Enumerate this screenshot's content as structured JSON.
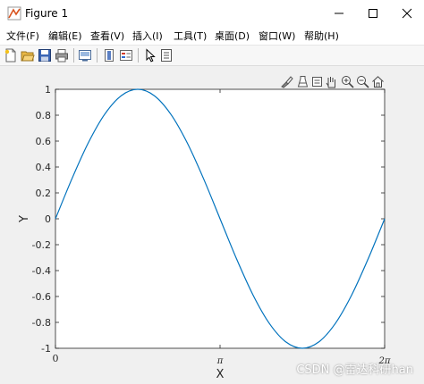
{
  "window": {
    "title": "Figure 1"
  },
  "menu": [
    {
      "label": "文件(F)"
    },
    {
      "label": "编辑(E)"
    },
    {
      "label": "查看(V)"
    },
    {
      "label": "插入(I)"
    },
    {
      "label": "工具(T)"
    },
    {
      "label": "桌面(D)"
    },
    {
      "label": "窗口(W)"
    },
    {
      "label": "帮助(H)"
    }
  ],
  "toolbar_icons": [
    "new-figure-icon",
    "open-file-icon",
    "save-icon",
    "print-icon",
    "link-plot-icon",
    "colorbar-icon",
    "legend-icon",
    "edit-plot-arrow-icon",
    "property-inspector-icon"
  ],
  "axes_toolbar_icons": [
    "brush-icon",
    "data-tips-icon",
    "pan-icon",
    "zoom-in-icon",
    "zoom-out-icon",
    "home-icon"
  ],
  "chart_data": {
    "type": "line",
    "function": "sin(x)",
    "xlabel": "X",
    "ylabel": "Y",
    "xlim": [
      0,
      6.2832
    ],
    "ylim": [
      -1,
      1
    ],
    "xticks": [
      0,
      3.1416,
      6.2832
    ],
    "xtick_labels": [
      "0",
      "π",
      "2π"
    ],
    "yticks": [
      1,
      0.8,
      0.6,
      0.4,
      0.2,
      0,
      -0.2,
      -0.4,
      -0.6,
      -0.8,
      -1
    ],
    "ytick_labels": [
      "1",
      "0.8",
      "0.6",
      "0.4",
      "0.2",
      "0",
      "-0.2",
      "-0.4",
      "-0.6",
      "-0.8",
      "-1"
    ],
    "series": [
      {
        "color": "#0072bd",
        "x": [
          0,
          0.3142,
          0.6283,
          0.9425,
          1.2566,
          1.5708,
          1.885,
          2.1991,
          2.5133,
          2.8274,
          3.1416,
          3.4558,
          3.7699,
          4.0841,
          4.3982,
          4.7124,
          5.0265,
          5.3407,
          5.6549,
          5.969,
          6.2832
        ],
        "y": [
          0,
          0.309,
          0.5878,
          0.809,
          0.9511,
          1,
          0.9511,
          0.809,
          0.5878,
          0.309,
          0,
          -0.309,
          -0.5878,
          -0.809,
          -0.9511,
          -1,
          -0.9511,
          -0.809,
          -0.5878,
          -0.309,
          0
        ]
      }
    ],
    "grid": false
  },
  "watermark": "CSDN @雷达科研han"
}
